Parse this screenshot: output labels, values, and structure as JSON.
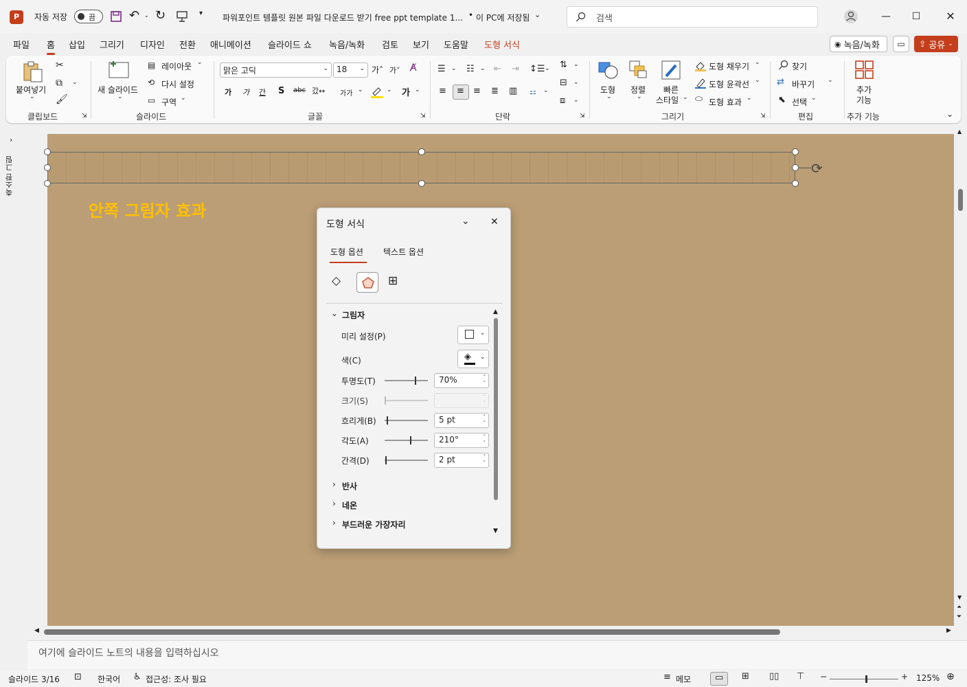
{
  "titlebar": {
    "autosave_label": "자동 저장",
    "autosave_state": "끔",
    "doc_title": "파워포인트 템플릿 원본 파일 다운로드 받기 free ppt template 1...",
    "save_location": "이 PC에 저장됨",
    "search_placeholder": "검색"
  },
  "tabs": [
    "파일",
    "홈",
    "삽입",
    "그리기",
    "디자인",
    "전환",
    "애니메이션",
    "슬라이드 쇼",
    "녹음/녹화",
    "검토",
    "보기",
    "도움말",
    "도형 서식"
  ],
  "active_tab": "홈",
  "top_buttons": {
    "record": "녹음/녹화",
    "share": "공유"
  },
  "ribbon": {
    "clipboard": {
      "paste": "붙여넣기",
      "label": "클립보드"
    },
    "slides": {
      "new_slide": "새 슬라이드",
      "layout": "레이아웃",
      "reset": "다시 설정",
      "section": "구역",
      "label": "슬라이드"
    },
    "font": {
      "font_name": "맑은 고딕",
      "font_size": "18",
      "label": "글꼴"
    },
    "paragraph": {
      "label": "단락"
    },
    "drawing": {
      "shapes": "도형",
      "arrange": "정렬",
      "quick_styles_1": "빠른",
      "quick_styles_2": "스타일",
      "shape_fill": "도형 채우기",
      "shape_outline": "도형 윤곽선",
      "shape_effects": "도형 효과",
      "label": "그리기"
    },
    "editing": {
      "find": "찾기",
      "replace": "바꾸기",
      "select": "선택",
      "label": "편집"
    },
    "addins": {
      "btn_1": "추가",
      "btn_2": "기능",
      "label": "추가 기능"
    }
  },
  "left_strip": {
    "label": "축소판 그림"
  },
  "slide": {
    "title_text": "안쪽 그림자 효과"
  },
  "format_panel": {
    "title": "도형 서식",
    "tabs": [
      "도형 옵션",
      "텍스트 옵션"
    ],
    "active_tab": "도형 옵션",
    "section_open": "그림자",
    "rows": {
      "preset": "미리 설정(P)",
      "color": "색(C)",
      "transparency": {
        "label": "투명도(T)",
        "value": "70%",
        "level": 0.7
      },
      "size": {
        "label": "크기(S)",
        "value": ""
      },
      "blur": {
        "label": "흐리게(B)",
        "value": "5 pt"
      },
      "angle": {
        "label": "각도(A)",
        "value": "210°"
      },
      "distance": {
        "label": "간격(D)",
        "value": "2 pt"
      }
    },
    "collapsed_sections": [
      "반사",
      "네온",
      "부드러운 가장자리"
    ]
  },
  "notes": {
    "placeholder": "여기에 슬라이드 노트의 내용을 입력하십시오"
  },
  "status": {
    "slide_info": "슬라이드 3/16",
    "language": "한국어",
    "accessibility": "접근성: 조사 필요",
    "notes_btn": "메모",
    "zoom": "125%"
  },
  "colors": {
    "accent": "#c43e1c",
    "slide_bg": "#bb9e76",
    "title_color": "#ffc000"
  }
}
